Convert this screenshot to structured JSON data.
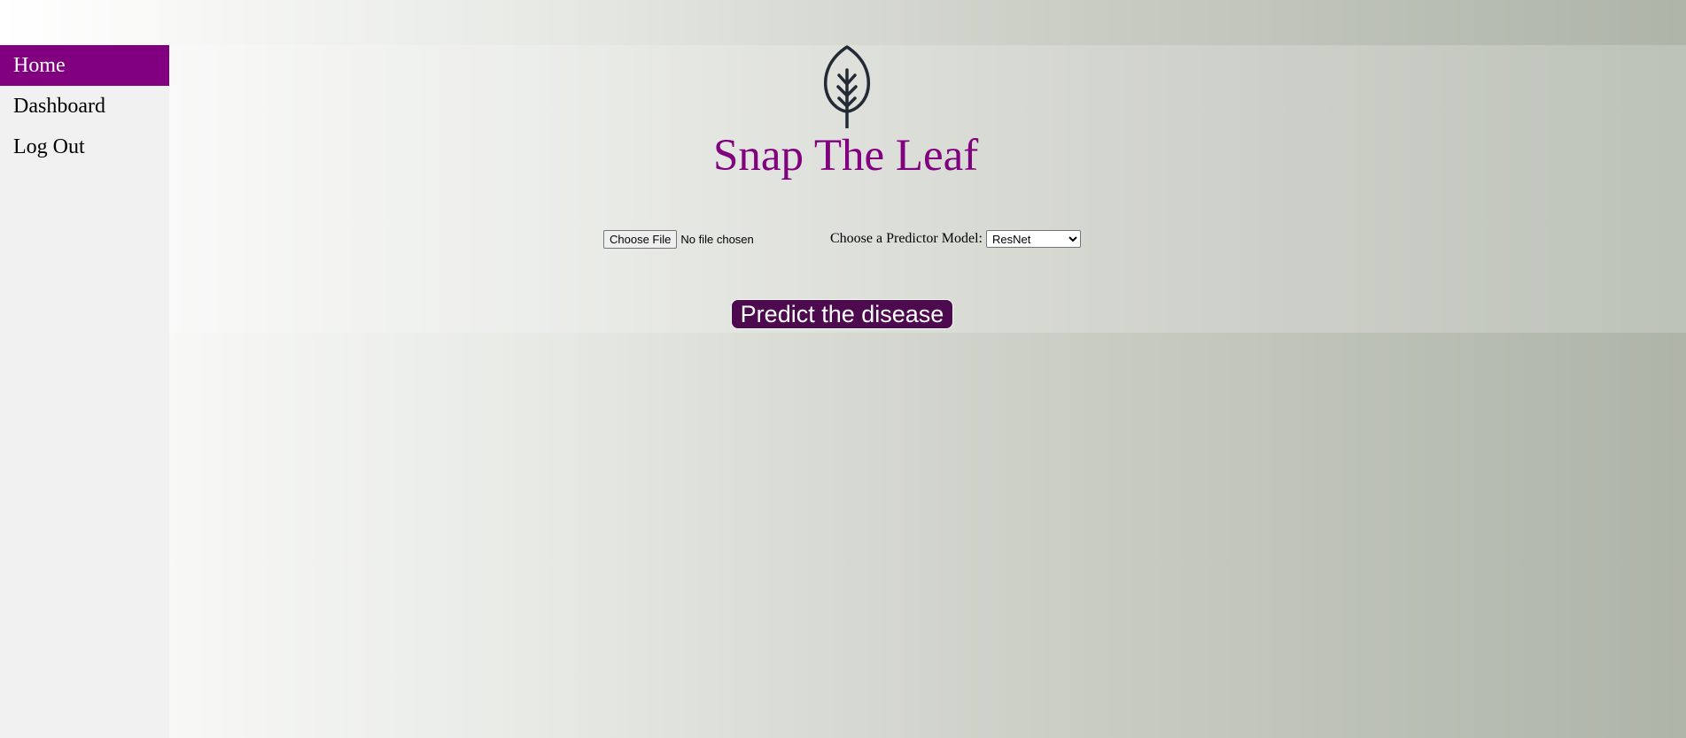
{
  "nav": {
    "items": [
      {
        "label": "Home",
        "active": true
      },
      {
        "label": "Dashboard",
        "active": false
      },
      {
        "label": "Log Out",
        "active": false
      }
    ]
  },
  "header": {
    "logo_icon": "leaf-icon",
    "title": "Snap The Leaf"
  },
  "upload": {
    "button_label": "Choose File",
    "status": "No file chosen"
  },
  "model": {
    "label": "Choose a Predictor Model:",
    "selected": "ResNet",
    "options": [
      "ResNet"
    ]
  },
  "predict": {
    "label": "Predict the disease"
  },
  "colors": {
    "accent": "#800080",
    "button_bg": "#4d0a4f",
    "title": "#800080",
    "logo_stroke": "#222a35"
  }
}
